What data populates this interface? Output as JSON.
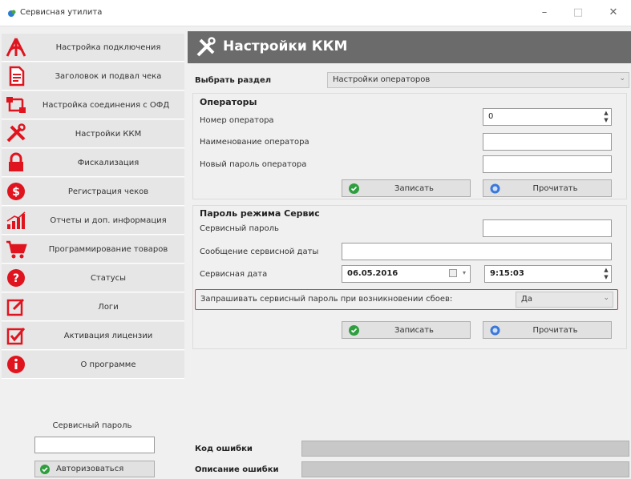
{
  "window": {
    "title": "Сервисная утилита",
    "minimize": "–",
    "maximize": "□",
    "close": "✕"
  },
  "sidebar": {
    "items": [
      {
        "label": "Настройка подключения",
        "icon": "antenna-icon"
      },
      {
        "label": "Заголовок и подвал чека",
        "icon": "document-icon"
      },
      {
        "label": "Настройка соединения с ОФД",
        "icon": "network-icon"
      },
      {
        "label": "Настройки ККМ",
        "icon": "tools-icon"
      },
      {
        "label": "Фискализация",
        "icon": "lock-icon"
      },
      {
        "label": "Регистрация чеков",
        "icon": "coin-icon"
      },
      {
        "label": "Отчеты и доп. информация",
        "icon": "chart-icon"
      },
      {
        "label": "Программирование товаров",
        "icon": "cart-icon"
      },
      {
        "label": "Статусы",
        "icon": "question-icon"
      },
      {
        "label": "Логи",
        "icon": "edit-icon"
      },
      {
        "label": "Активация лицензии",
        "icon": "checkbox-icon"
      },
      {
        "label": "О программе",
        "icon": "info-icon"
      }
    ],
    "password_label": "Сервисный пароль",
    "password_value": "",
    "auth_button": "Авторизоваться"
  },
  "header": {
    "title": "Настройки ККМ"
  },
  "section_select": {
    "label": "Выбрать раздел",
    "value": "Настройки операторов"
  },
  "operators": {
    "title": "Операторы",
    "number_label": "Номер оператора",
    "number_value": "0",
    "name_label": "Наименование оператора",
    "name_value": "",
    "new_password_label": "Новый пароль оператора",
    "new_password_value": "",
    "write_button": "Записать",
    "read_button": "Прочитать"
  },
  "service_mode": {
    "title": "Пароль режима Сервис",
    "password_label": "Сервисный пароль",
    "password_value": "",
    "message_label": "Сообщение сервисной даты",
    "message_value": "",
    "date_label": "Сервисная дата",
    "date_value": "06.05.2016",
    "time_value": "9:15:03",
    "ask_label": "Запрашивать сервисный пароль при возникновении сбоев:",
    "ask_value": "Да",
    "write_button": "Записать",
    "read_button": "Прочитать"
  },
  "errors": {
    "code_label": "Код ошибки",
    "desc_label": "Описание ошибки"
  },
  "colors": {
    "accent_red": "#e0141e",
    "header_gray": "#6b6b6b",
    "highlight_red": "#d33a3a",
    "ok_green": "#2e9e3e",
    "read_blue": "#3b78d8"
  }
}
